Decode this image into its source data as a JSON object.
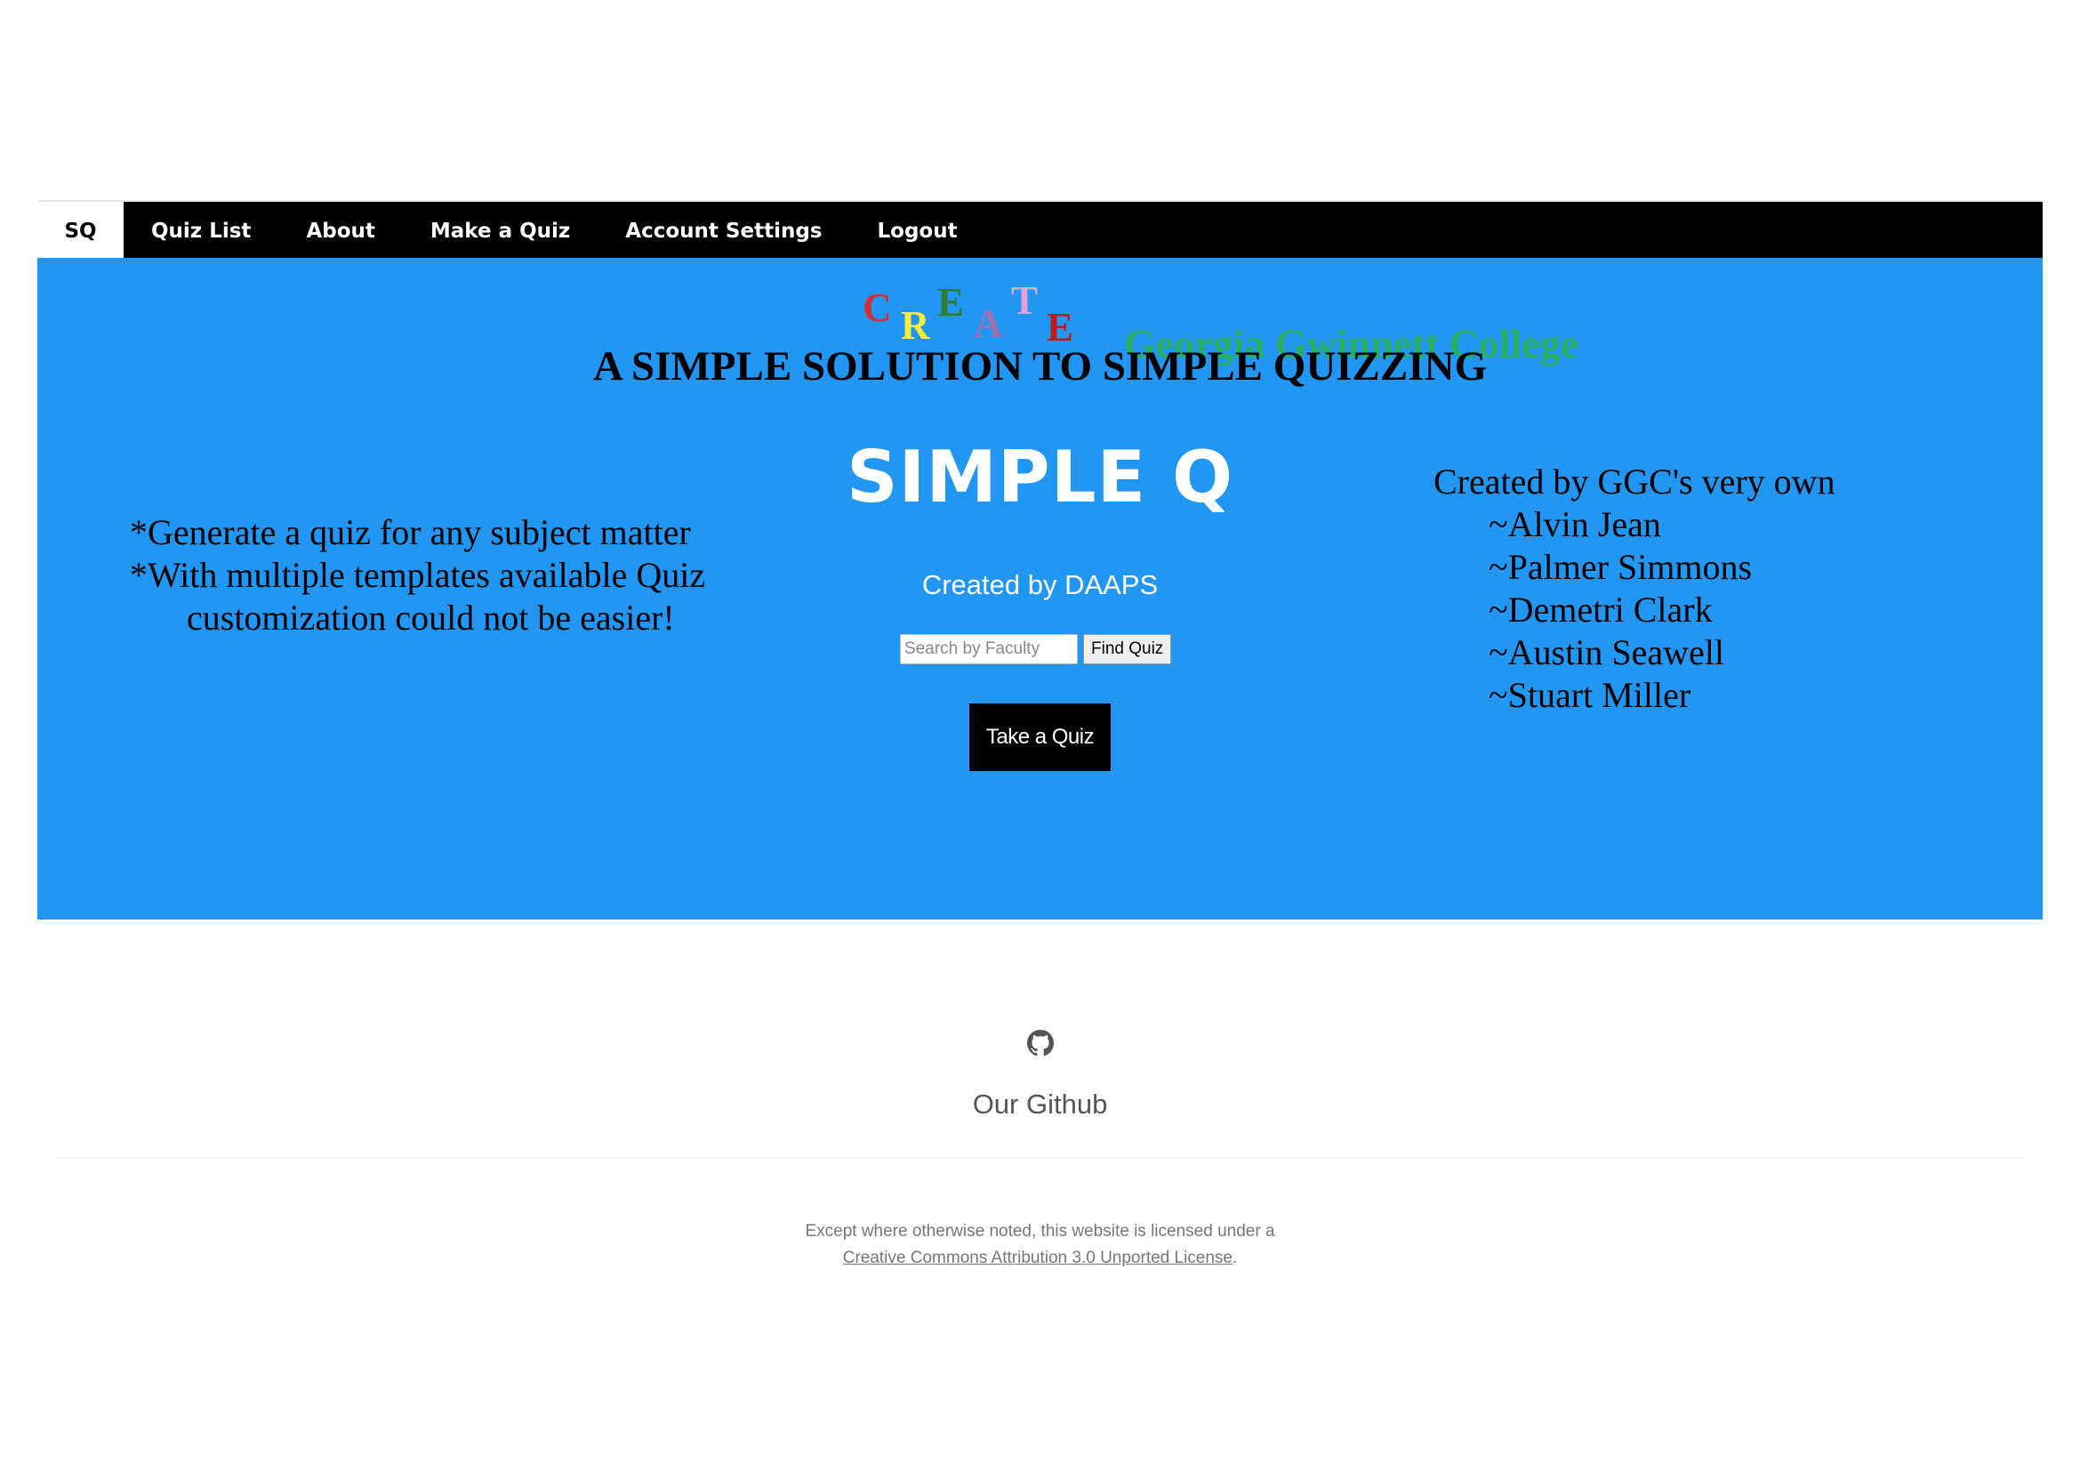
{
  "nav": {
    "brand": "SQ",
    "items": [
      "Quiz List",
      "About",
      "Make a Quiz",
      "Account Settings",
      "Logout"
    ]
  },
  "hero": {
    "create_letters": [
      {
        "letter": "C",
        "color": "#d32f2f"
      },
      {
        "letter": "R",
        "color": "#ffeb3b"
      },
      {
        "letter": "E",
        "color": "#2e7d32"
      },
      {
        "letter": "A",
        "color": "#9c6fb3"
      },
      {
        "letter": "T",
        "color": "#e5a2d6"
      },
      {
        "letter": "E",
        "color": "#b71c1c"
      }
    ],
    "college": "Georgia Gwinnett College",
    "college_color": "#27ae60",
    "tagline": "A SIMPLE SOLUTION TO SIMPLE QUIZZING",
    "title": "SIMPLE Q",
    "byline": "Created by DAAPS",
    "search_placeholder": "Search by Faculty",
    "find_button": "Find Quiz",
    "take_button": "Take a Quiz",
    "features": [
      "*Generate a quiz for any subject matter",
      "*With multiple templates available Quiz",
      "customization could not be easier!"
    ],
    "credits_heading": "Created by GGC's very own",
    "members": [
      "~Alvin Jean",
      "~Palmer Simmons",
      "~Demetri Clark",
      "~Austin Seawell",
      "~Stuart Miller"
    ],
    "background_color": "#2196f3"
  },
  "footer": {
    "github_icon": "github-icon",
    "github_label": "Our Github",
    "license_text": "Except where otherwise noted, this website is licensed under a",
    "license_link": "Creative Commons Attribution 3.0 Unported License",
    "license_end": "."
  }
}
